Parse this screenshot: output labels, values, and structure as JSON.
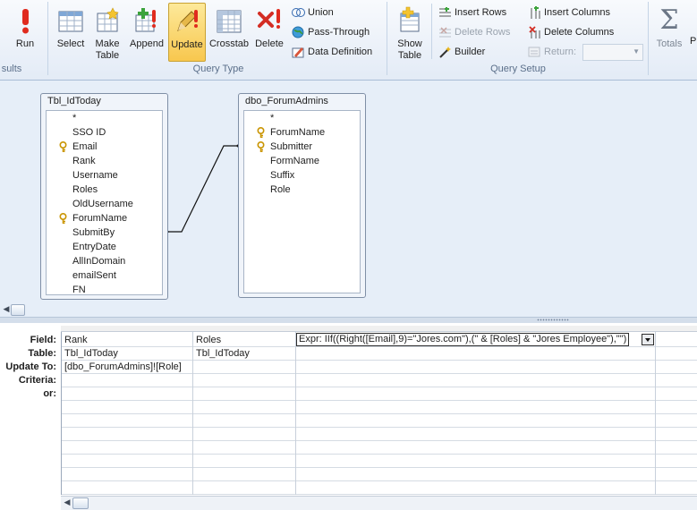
{
  "ribbon": {
    "results_group_label": "sults",
    "run_label": "Run",
    "select_label": "Select",
    "make_table_label_1": "Make",
    "make_table_label_2": "Table",
    "append_label": "Append",
    "update_label": "Update",
    "crosstab_label": "Crosstab",
    "delete_label": "Delete",
    "union_label": "Union",
    "passthrough_label": "Pass-Through",
    "data_definition_label": "Data Definition",
    "query_type_group_label": "Query Type",
    "show_table_label_1": "Show",
    "show_table_label_2": "Table",
    "insert_rows_label": "Insert Rows",
    "delete_rows_label": "Delete Rows",
    "builder_label": "Builder",
    "insert_columns_label": "Insert Columns",
    "delete_columns_label": "Delete Columns",
    "return_label": "Return:",
    "return_value": "",
    "query_setup_group_label": "Query Setup",
    "totals_label": "Totals",
    "truncated_next_label": "P"
  },
  "tables": [
    {
      "title": "Tbl_IdToday",
      "fields": [
        {
          "name": "*",
          "key": false
        },
        {
          "name": "SSO ID",
          "key": false
        },
        {
          "name": "Email",
          "key": true
        },
        {
          "name": "Rank",
          "key": false
        },
        {
          "name": "Username",
          "key": false
        },
        {
          "name": "Roles",
          "key": false
        },
        {
          "name": "OldUsername",
          "key": false
        },
        {
          "name": "ForumName",
          "key": true
        },
        {
          "name": "SubmitBy",
          "key": false
        },
        {
          "name": "EntryDate",
          "key": false
        },
        {
          "name": "AllInDomain",
          "key": false
        },
        {
          "name": "emailSent",
          "key": false
        },
        {
          "name": "FN",
          "key": false
        }
      ]
    },
    {
      "title": "dbo_ForumAdmins",
      "fields": [
        {
          "name": "*",
          "key": false
        },
        {
          "name": "ForumName",
          "key": true
        },
        {
          "name": "Submitter",
          "key": true
        },
        {
          "name": "FormName",
          "key": false
        },
        {
          "name": "Suffix",
          "key": false
        },
        {
          "name": "Role",
          "key": false
        }
      ]
    }
  ],
  "grid": {
    "row_labels": [
      "Field:",
      "Table:",
      "Update To:",
      "Criteria:",
      "or:"
    ],
    "columns": [
      {
        "field": "Rank",
        "table": "Tbl_IdToday",
        "update_to": "[dbo_ForumAdmins]![Role]",
        "criteria": "",
        "or": ""
      },
      {
        "field": "Roles",
        "table": "Tbl_IdToday",
        "update_to": "",
        "criteria": "",
        "or": ""
      },
      {
        "field": "Expr: IIf((Right([Email],9)=\"Jores.com\"),(\" & [Roles] & \"Jores Employee\"),\"\")",
        "table": "",
        "update_to": "",
        "criteria": "",
        "or": ""
      }
    ]
  },
  "colors": {
    "ribbon_bg": "#e3ebf6",
    "active_button": "#f8c74e",
    "design_pane_bg": "#e6eef8",
    "key_icon": "#d8a400"
  }
}
